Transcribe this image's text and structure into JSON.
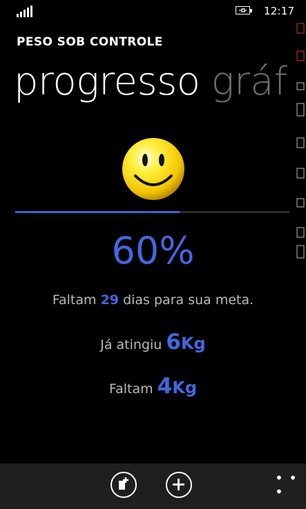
{
  "status_bar": {
    "time": "12:17"
  },
  "header": {
    "app_title": "PESO SOB CONTROLE",
    "pivots": [
      "progresso",
      "gráf"
    ]
  },
  "progress": {
    "fraction": 0.6,
    "percent_label": "60%",
    "fill_color": "#3b63d9"
  },
  "days_line": {
    "prefix": "Faltam ",
    "days": "29",
    "suffix": " dias para sua meta."
  },
  "reached_line": {
    "prefix": "Já atingiu ",
    "value": "6",
    "unit": "Kg"
  },
  "remaining_line": {
    "prefix": "Faltam ",
    "value": "4",
    "unit": "Kg"
  },
  "app_bar": {
    "buttons": [
      "new-entry-icon",
      "add-icon"
    ],
    "more_label": "• • •"
  },
  "colors": {
    "accent": "#4466e0",
    "background": "#000000",
    "appbar": "#1f1f1f"
  }
}
